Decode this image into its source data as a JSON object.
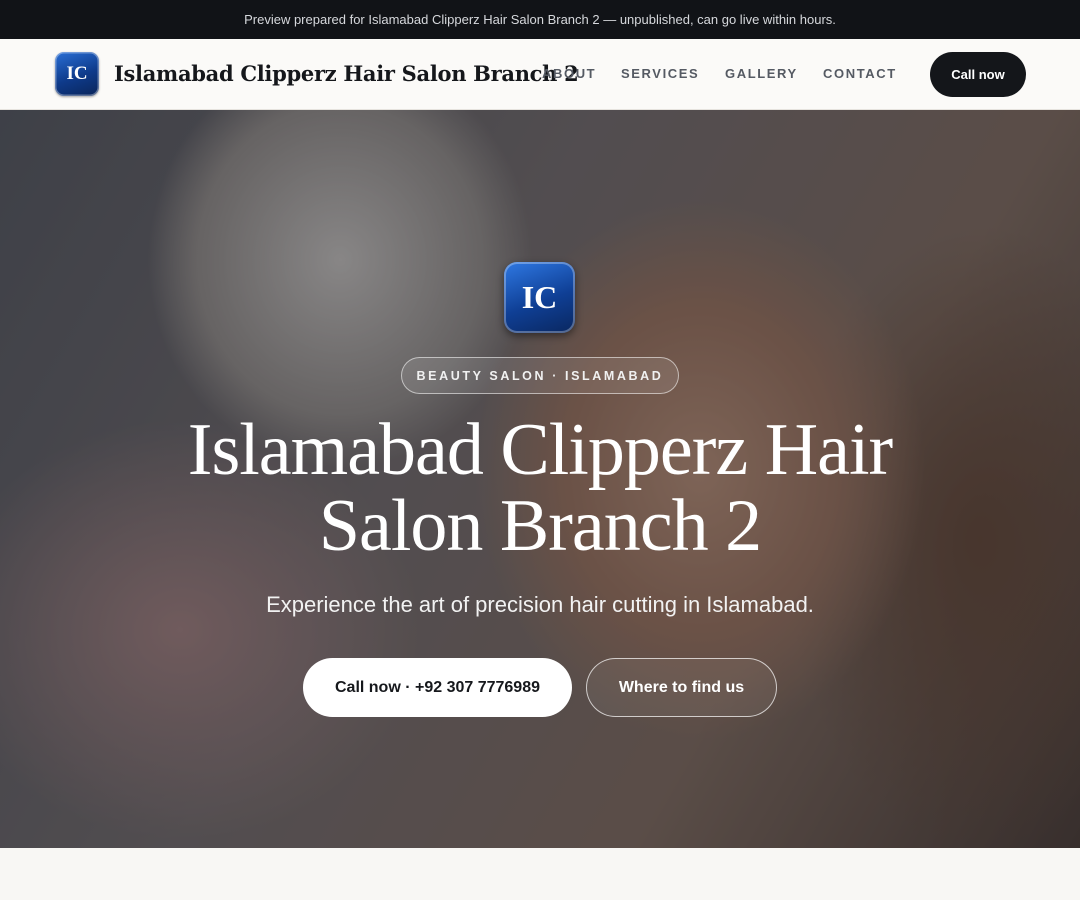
{
  "preview_banner": {
    "text": "Preview prepared for Islamabad Clipperz Hair Salon Branch 2 — unpublished, can go live within hours."
  },
  "nav": {
    "logo_text": "IC",
    "brand_name": "Islamabad Clipperz Hair Salon Branch 2",
    "links": [
      "About",
      "Services",
      "Gallery",
      "Contact"
    ],
    "cta_label": "Call now"
  },
  "hero": {
    "logo_text": "IC",
    "badge": "BEAUTY SALON · ISLAMABAD",
    "title_line1": "Islamabad Clipperz Hair",
    "title_line2": "Salon Branch 2",
    "subtitle": "Experience the art of precision hair cutting in Islamabad.",
    "primary_button": "Call now · +92 307 7776989",
    "secondary_button": "Where to find us"
  },
  "colors": {
    "banner_bg": "#111317",
    "brand_blue": "#0f3f95",
    "cta_dark": "#14161a",
    "page_bg": "#f8f7f4"
  }
}
